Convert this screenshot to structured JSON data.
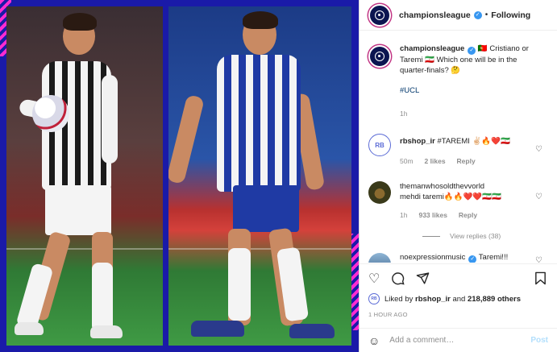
{
  "header": {
    "username": "championsleague",
    "separator": "•",
    "follow_status": "Following"
  },
  "caption": {
    "username": "championsleague",
    "text_1": " 🇵🇹 Cristiano or Taremi 🇮🇷 Which one will be in the quarter-finals? 🤔",
    "hashtag": "#UCL",
    "time": "1h"
  },
  "comments": [
    {
      "username": "rbshop_ir",
      "text": " #TAREMI ✌🏻🔥❤️🇮🇷",
      "time": "50m",
      "likes": "2 likes",
      "reply": "Reply",
      "avatar_text": "RB"
    },
    {
      "username": "themanwhosoldthevvorld",
      "text": "mehdi taremi🔥🔥❤️❤️🇮🇷🇮🇷",
      "time": "1h",
      "likes": "933 likes",
      "reply": "Reply",
      "view_replies": "View replies (38)"
    },
    {
      "username": "noexpressionmusic",
      "text": " Taremi!!!"
    }
  ],
  "actions": {
    "liked_by_prefix": "Liked by ",
    "liked_by_user": "rbshop_ir",
    "liked_by_and": " and ",
    "liked_by_others": "218,889 others",
    "time_ago": "1 HOUR AGO",
    "like_icon": "heart-icon",
    "comment_icon": "comment-icon",
    "share_icon": "share-icon",
    "save_icon": "bookmark-icon"
  },
  "add_comment": {
    "placeholder": "Add a comment…",
    "post_label": "Post"
  },
  "colors": {
    "verified": "#3897f0",
    "link": "#00376b",
    "muted": "#8e8e8e",
    "post_disabled": "#b2dffc",
    "media_bg": "#1a1aa8"
  }
}
